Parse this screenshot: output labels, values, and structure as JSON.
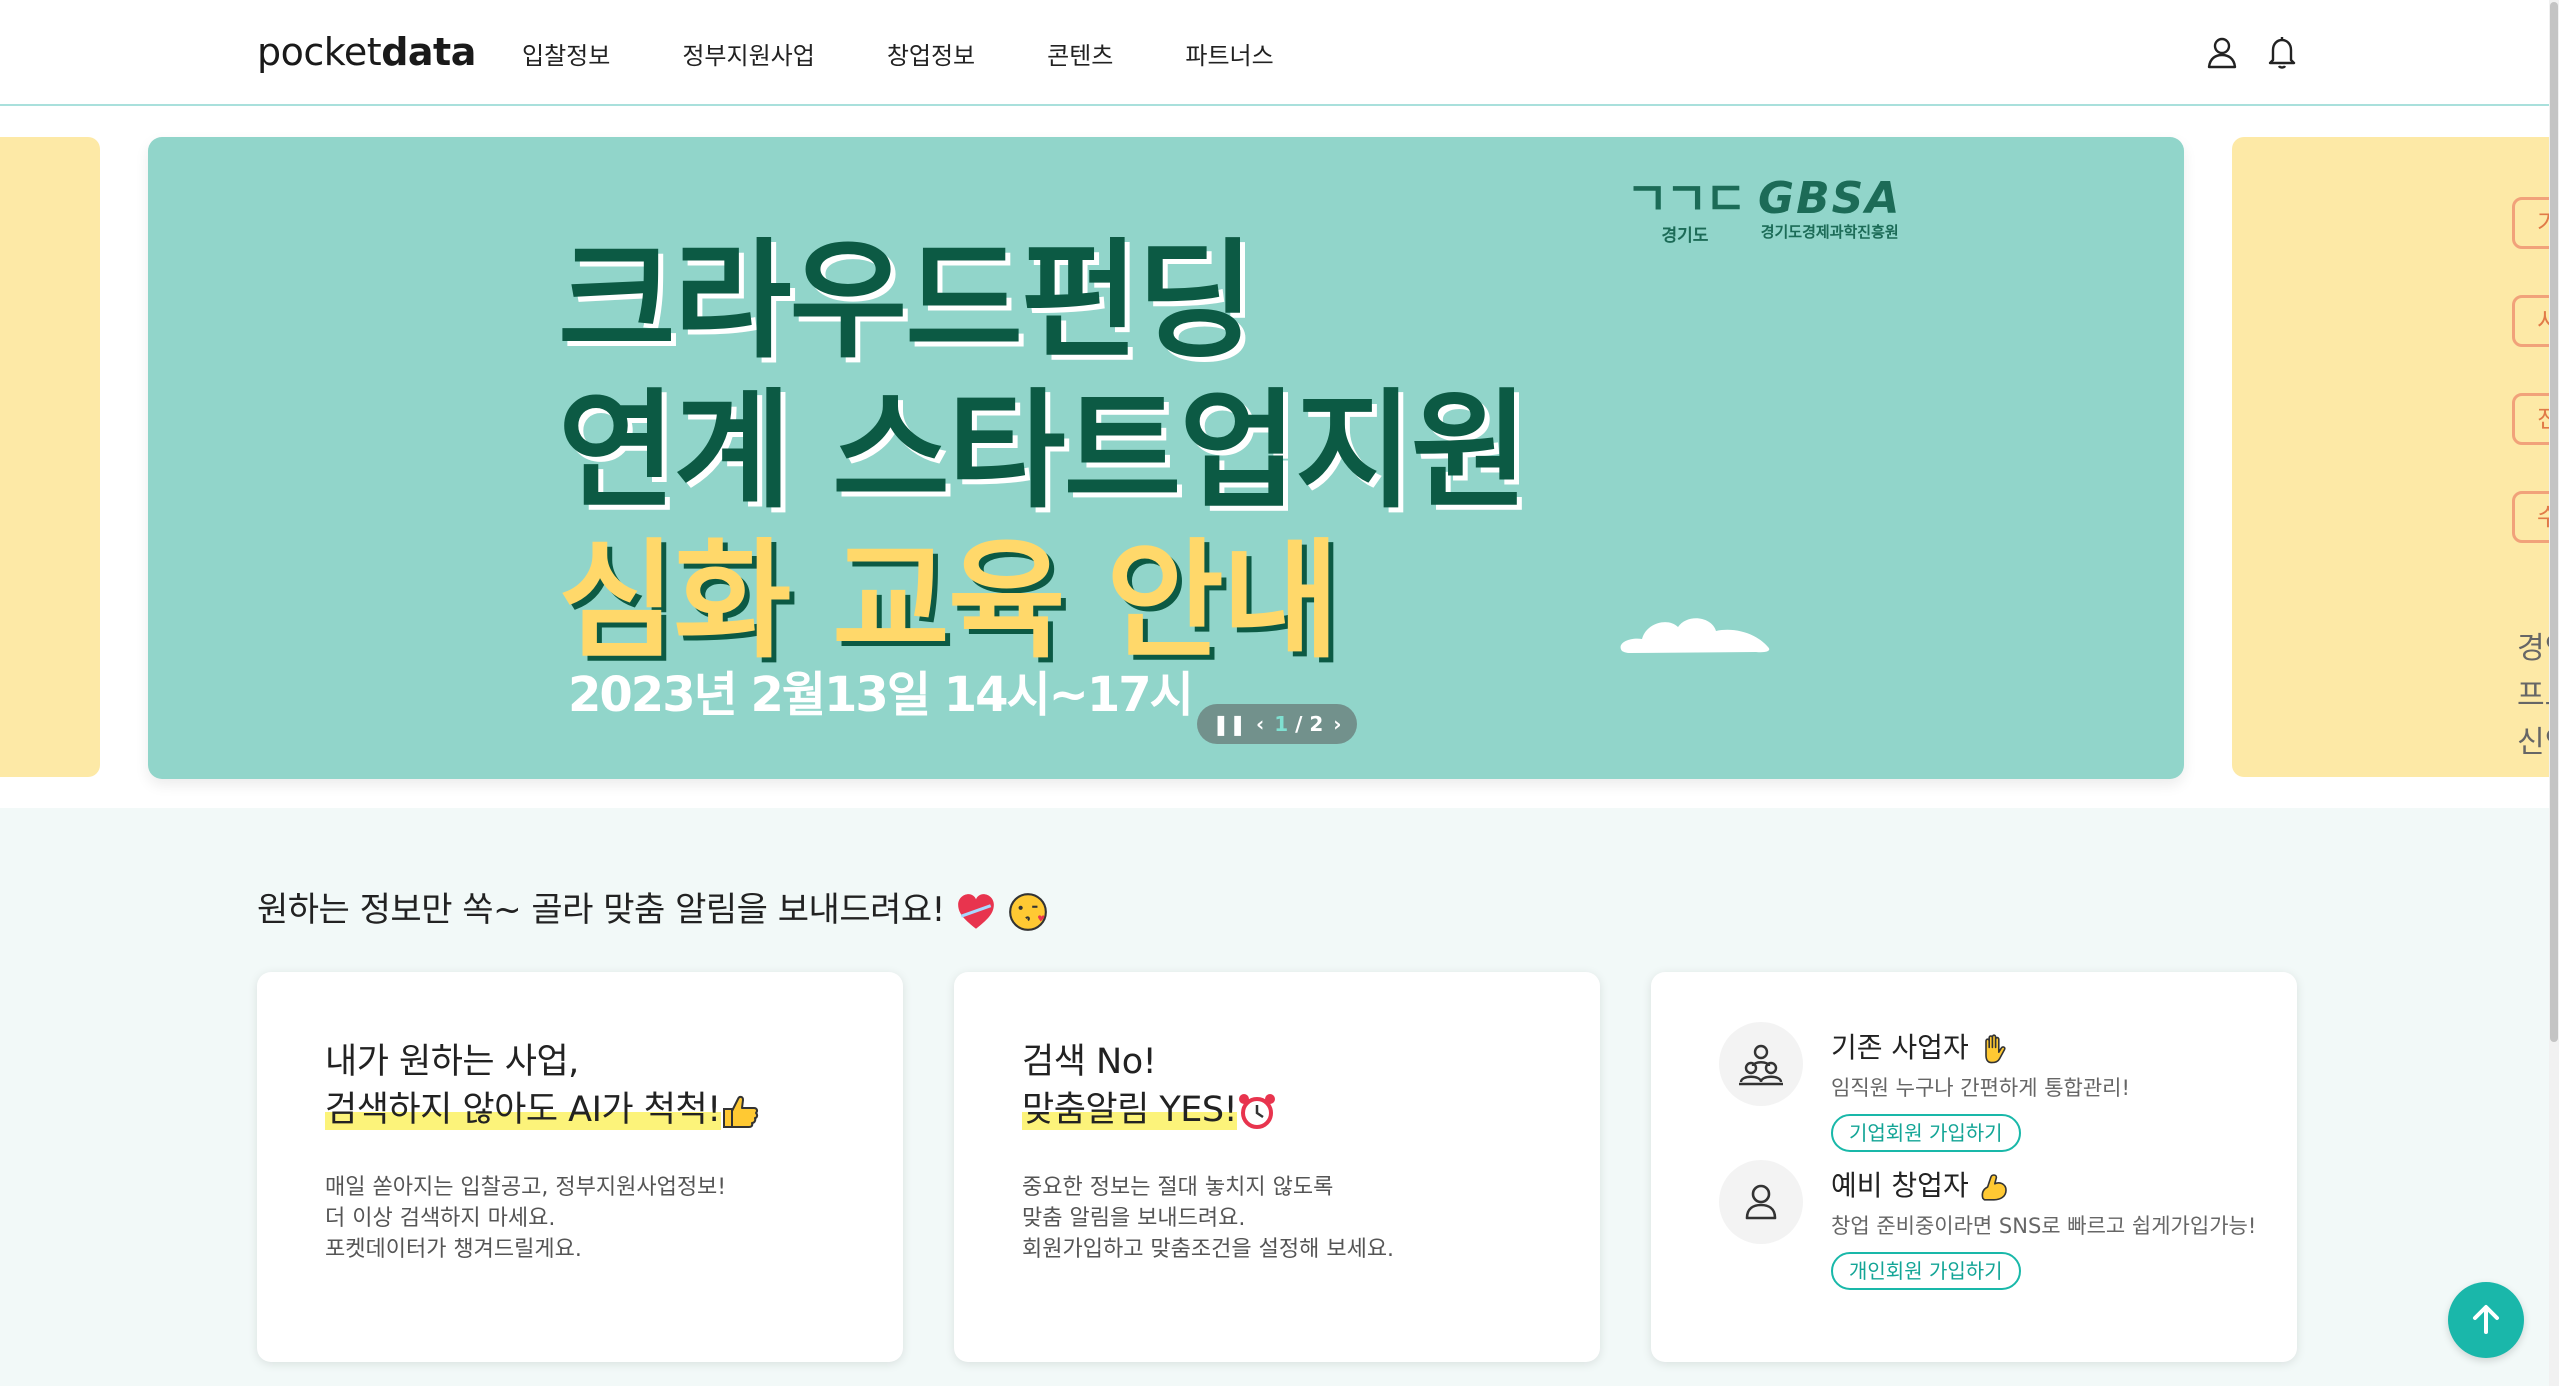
{
  "header": {
    "logo_part1": "pocket",
    "logo_part2": "data",
    "nav": [
      "입찰정보",
      "정부지원사업",
      "창업정보",
      "콘텐츠",
      "파트너스"
    ],
    "icons": [
      "user-icon",
      "bell-icon"
    ]
  },
  "banner": {
    "title_line1": "크라우드펀딩",
    "title_line2": "연계 스타트업지원",
    "title_line3": "심화 교육 안내",
    "date_text": "2023년 2월13일 14시~17시",
    "logo1_mark": "ㄱㄱㄷ",
    "logo1_caption": "경기도",
    "logo2_mark": "GBSA",
    "logo2_caption": "경기도경제과학진흥원",
    "colors": {
      "background": "#91d5ca",
      "title": "#0c5a44",
      "highlight": "#ffd86a"
    }
  },
  "side_banner_right": {
    "tags": [
      "기",
      "시",
      "진",
      "수"
    ],
    "text": "경인\n프로\n신인"
  },
  "pager": {
    "current": "1",
    "separator": "/",
    "total": "2"
  },
  "section": {
    "title": "원하는 정보만 쏙~ 골라 맞춤 알림을 보내드려요!"
  },
  "cards": [
    {
      "head_line1": "내가 원하는 사업,",
      "head_line2": "검색하지 않아도 AI가 척척!",
      "desc": [
        "매일 쏟아지는 입찰공고, 정부지원사업정보!",
        "더 이상 검색하지 마세요.",
        "포켓데이터가 챙겨드릴게요."
      ]
    },
    {
      "head_line1": "검색 No!",
      "head_line2": "맞춤알림 YES!",
      "desc": [
        "중요한 정보는 절대 놓치지 않도록",
        "맞춤 알림을 보내드려요.",
        "회원가입하고 맞춤조건을 설정해 보세요."
      ]
    }
  ],
  "membership": [
    {
      "title": "기존 사업자",
      "sub": "임직원 누구나 간편하게 통합관리!",
      "button": "기업회원 가입하기"
    },
    {
      "title": "예비 창업자",
      "sub": "창업 준비중이라면 SNS로 빠르고 쉽게가입가능!",
      "button": "개인회원 가입하기"
    }
  ],
  "accent_color": "#1ab7aa"
}
